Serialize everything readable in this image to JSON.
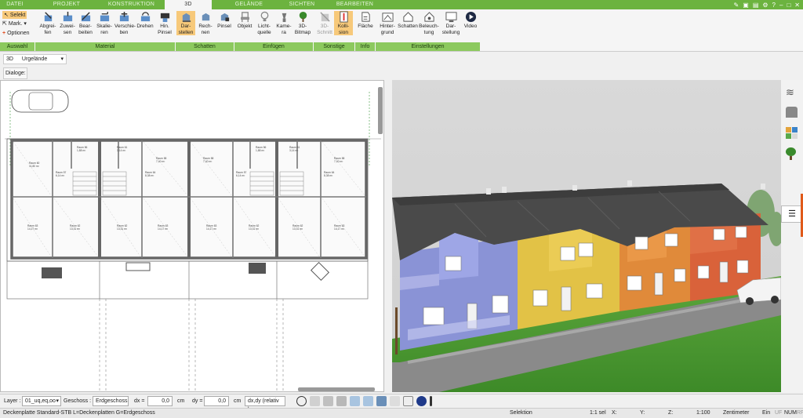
{
  "tabs": [
    "DATEI",
    "PROJEKT",
    "KONSTRUKTION",
    "3D",
    "GELÄNDE",
    "SICHTEN",
    "BEARBEITEN"
  ],
  "active_tab": "3D",
  "ribbon": {
    "auswahl": {
      "selekt": "Selekt",
      "mark": "Mark.",
      "optionen": "Optionen"
    },
    "material": [
      {
        "l1": "Abgrei-",
        "l2": "fen"
      },
      {
        "l1": "Zuwei-",
        "l2": "sen"
      },
      {
        "l1": "Bear-",
        "l2": "beiten"
      },
      {
        "l1": "Skalie-",
        "l2": "ren"
      },
      {
        "l1": "Verschie-",
        "l2": "ben"
      },
      {
        "l1": "Drehen",
        "l2": ""
      },
      {
        "l1": "Hin.",
        "l2": "Pinsel"
      }
    ],
    "schatten": [
      {
        "l1": "Dar-",
        "l2": "stellen"
      },
      {
        "l1": "Rech-",
        "l2": "nen"
      },
      {
        "l1": "Pinsel",
        "l2": ""
      }
    ],
    "einfuegen": [
      {
        "l1": "Objekt",
        "l2": ""
      },
      {
        "l1": "Licht-",
        "l2": "quelle"
      },
      {
        "l1": "Kame-",
        "l2": "ra"
      },
      {
        "l1": "3D-",
        "l2": "Bitmap"
      }
    ],
    "sonstige": [
      {
        "l1": "3D-",
        "l2": "Schnitt"
      },
      {
        "l1": "Kolli-",
        "l2": "sion"
      }
    ],
    "info": [
      {
        "l1": "Fläche",
        "l2": ""
      }
    ],
    "einstellungen": [
      {
        "l1": "Hinter-",
        "l2": "grund"
      },
      {
        "l1": "Schatten",
        "l2": ""
      },
      {
        "l1": "Beleuch-",
        "l2": "tung"
      },
      {
        "l1": "Dar-",
        "l2": "stellung"
      },
      {
        "l1": "Video",
        "l2": ""
      }
    ],
    "groups": [
      "Auswahl",
      "Material",
      "Schatten",
      "Einfügen",
      "Sonstige",
      "Info",
      "Einstellungen"
    ]
  },
  "view_selector": {
    "mode": "3D",
    "value": "Urgelände"
  },
  "dialoge_label": "Dialoge:",
  "plan_rooms": [
    {
      "name": "Raum 56",
      "area": "1,88 m²"
    },
    {
      "name": "Raum 58",
      "area": "7,40 m²"
    },
    {
      "name": "Raum 60",
      "area": "11,80 m²"
    },
    {
      "name": "Raum 57",
      "area": "6,14 m²"
    },
    {
      "name": "Raum 61",
      "area": "3,14 m²"
    },
    {
      "name": "Raum 63",
      "area": "14,17 m²"
    },
    {
      "name": "Raum 62",
      "area": "13,31 m²"
    },
    {
      "name": "Raum 64",
      "area": "8,38 m²"
    }
  ],
  "bottom": {
    "layer_label": "Layer :",
    "layer_value": "01_uq,eq,oo",
    "geschoss_label": "Geschoss :",
    "geschoss_value": "Erdgeschoss",
    "dx_label": "dx =",
    "dx_value": "0,0",
    "dx_unit": "cm",
    "dy_label": "dy =",
    "dy_value": "0,0",
    "dy_unit": "cm",
    "mode_value": "dx,dy (relativ ka"
  },
  "status": {
    "left": "Deckenplatte Standard-STB L=Deckenplatten G=Erdgeschoss",
    "mode": "Selektion",
    "sel": "1:1 sel",
    "x": "X:",
    "y": "Y:",
    "z": "Z:",
    "scale": "1:100",
    "unit": "Zentimeter",
    "ein": "Ein",
    "uf": "UF",
    "num": "NUM",
    "rf": "RF"
  },
  "colors": {
    "accent": "#6cb33f",
    "ribbon_group": "#8cc95e",
    "selected": "#f7c97a",
    "grass": "#4f9a35",
    "roof": "#4a4a4a"
  }
}
